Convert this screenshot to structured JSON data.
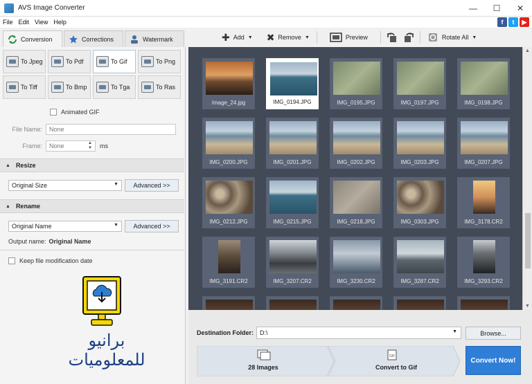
{
  "window": {
    "title": "AVS Image Converter",
    "minimize": "—",
    "maximize": "☐",
    "close": "✕"
  },
  "menu": [
    "File",
    "Edit",
    "View",
    "Help"
  ],
  "social": [
    {
      "name": "facebook",
      "glyph": "f",
      "color": "#3b5998"
    },
    {
      "name": "twitter",
      "glyph": "t",
      "color": "#1da1f2"
    },
    {
      "name": "youtube",
      "glyph": "▶",
      "color": "#e62117"
    }
  ],
  "tabs": [
    {
      "label": "Conversion",
      "active": true
    },
    {
      "label": "Corrections",
      "active": false
    },
    {
      "label": "Watermark",
      "active": false
    }
  ],
  "toolbar": {
    "add": "Add",
    "remove": "Remove",
    "preview": "Preview",
    "rotate_all": "Rotate All"
  },
  "formats": [
    {
      "label": "To Jpeg",
      "active": false
    },
    {
      "label": "To Pdf",
      "active": false
    },
    {
      "label": "To Gif",
      "active": true
    },
    {
      "label": "To Png",
      "active": false
    },
    {
      "label": "To Tiff",
      "active": false
    },
    {
      "label": "To Bmp",
      "active": false
    },
    {
      "label": "To Tga",
      "active": false
    },
    {
      "label": "To Ras",
      "active": false
    }
  ],
  "options": {
    "animated_gif": "Animated GIF",
    "file_name_label": "File Name:",
    "file_name_placeholder": "None",
    "frame_label": "Frame:",
    "frame_value": "None",
    "frame_unit": "ms"
  },
  "resize": {
    "title": "Resize",
    "select_value": "Original Size",
    "advanced": "Advanced >>"
  },
  "rename": {
    "title": "Rename",
    "select_value": "Original Name",
    "advanced": "Advanced >>",
    "output_label": "Output name:",
    "output_value": "Original Name"
  },
  "keep_date": "Keep file modification date",
  "logo_text": "برانيو للمعلوميات",
  "images": [
    {
      "name": "Image_24.jpg",
      "kind": "sunset",
      "selected": false
    },
    {
      "name": "IMG_0194.JPG",
      "kind": "sea",
      "selected": true
    },
    {
      "name": "IMG_0195.JPG",
      "kind": "water",
      "selected": false
    },
    {
      "name": "IMG_0197.JPG",
      "kind": "water",
      "selected": false
    },
    {
      "name": "IMG_0198.JPG",
      "kind": "water",
      "selected": false
    },
    {
      "name": "IMG_0200.JPG",
      "kind": "beach",
      "selected": false
    },
    {
      "name": "IMG_0201.JPG",
      "kind": "beach",
      "selected": false
    },
    {
      "name": "IMG_0202.JPG",
      "kind": "beach",
      "selected": false
    },
    {
      "name": "IMG_0203.JPG",
      "kind": "beach",
      "selected": false
    },
    {
      "name": "IMG_0207.JPG",
      "kind": "beach",
      "selected": false
    },
    {
      "name": "IMG_0212.JPG",
      "kind": "pebbles",
      "selected": false
    },
    {
      "name": "IMG_0215.JPG",
      "kind": "sea",
      "selected": false
    },
    {
      "name": "IMG_0218.JPG",
      "kind": "sand",
      "selected": false
    },
    {
      "name": "IMG_0303.JPG",
      "kind": "pebbles",
      "selected": false
    },
    {
      "name": "IMG_3178.CR2",
      "kind": "portrait-sunset",
      "selected": false
    },
    {
      "name": "IMG_3191.CR2",
      "kind": "portrait-dark",
      "selected": false
    },
    {
      "name": "IMG_3207.CR2",
      "kind": "storm",
      "selected": false
    },
    {
      "name": "IMG_3230.CR2",
      "kind": "statue",
      "selected": false
    },
    {
      "name": "IMG_3287.CR2",
      "kind": "pier",
      "selected": false
    },
    {
      "name": "IMG_3293.CR2",
      "kind": "portrait-tree",
      "selected": false
    },
    {
      "name": "",
      "kind": "dark",
      "selected": false
    },
    {
      "name": "",
      "kind": "dark",
      "selected": false
    },
    {
      "name": "",
      "kind": "dark",
      "selected": false
    },
    {
      "name": "",
      "kind": "dark",
      "selected": false
    },
    {
      "name": "",
      "kind": "dark",
      "selected": false
    }
  ],
  "destination": {
    "label": "Destination Folder:",
    "value": "D:\\",
    "browse": "Browse..."
  },
  "steps": {
    "count": "28 Images",
    "convert_to": "Convert to Gif",
    "convert_now": "Convert Now!"
  }
}
